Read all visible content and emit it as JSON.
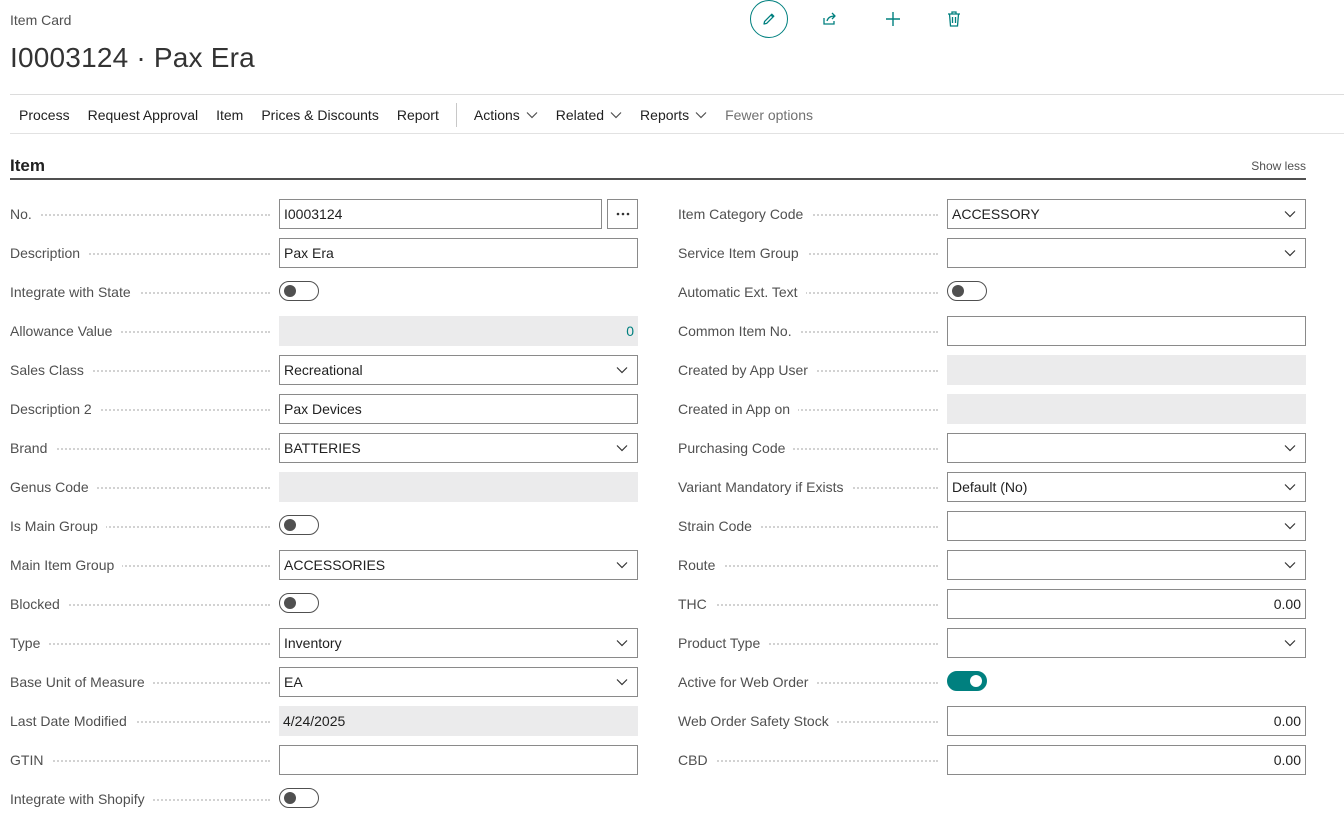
{
  "header": {
    "breadcrumb": "Item Card",
    "title": "I0003124 · Pax Era"
  },
  "top_actions": [
    {
      "name": "edit-icon"
    },
    {
      "name": "share-icon"
    },
    {
      "name": "plus-icon"
    },
    {
      "name": "trash-icon"
    }
  ],
  "menu": {
    "process": "Process",
    "request_approval": "Request Approval",
    "item": "Item",
    "prices_discounts": "Prices & Discounts",
    "report": "Report",
    "actions": "Actions",
    "related": "Related",
    "reports": "Reports",
    "fewer_options": "Fewer options"
  },
  "section": {
    "title": "Item",
    "show_less": "Show less"
  },
  "left": {
    "no": {
      "label": "No.",
      "value": "I0003124"
    },
    "description": {
      "label": "Description",
      "value": "Pax Era"
    },
    "integrate_state": {
      "label": "Integrate with State",
      "on": false
    },
    "allowance_value": {
      "label": "Allowance Value",
      "value": "0"
    },
    "sales_class": {
      "label": "Sales Class",
      "value": "Recreational"
    },
    "description2": {
      "label": "Description 2",
      "value": "Pax Devices"
    },
    "brand": {
      "label": "Brand",
      "value": "BATTERIES"
    },
    "genus_code": {
      "label": "Genus Code",
      "value": ""
    },
    "is_main_group": {
      "label": "Is Main Group",
      "on": false
    },
    "main_item_group": {
      "label": "Main Item Group",
      "value": "ACCESSORIES"
    },
    "blocked": {
      "label": "Blocked",
      "on": false
    },
    "type": {
      "label": "Type",
      "value": "Inventory"
    },
    "base_uom": {
      "label": "Base Unit of Measure",
      "value": "EA"
    },
    "last_date_modified": {
      "label": "Last Date Modified",
      "value": "4/24/2025"
    },
    "gtin": {
      "label": "GTIN",
      "value": ""
    },
    "integrate_shopify": {
      "label": "Integrate with Shopify",
      "on": false
    }
  },
  "right": {
    "item_category_code": {
      "label": "Item Category Code",
      "value": "ACCESSORY"
    },
    "service_item_group": {
      "label": "Service Item Group",
      "value": ""
    },
    "automatic_ext_text": {
      "label": "Automatic Ext. Text",
      "on": false
    },
    "common_item_no": {
      "label": "Common Item No.",
      "value": ""
    },
    "created_by_app_user": {
      "label": "Created by App User",
      "value": ""
    },
    "created_in_app_on": {
      "label": "Created in App on",
      "value": ""
    },
    "purchasing_code": {
      "label": "Purchasing Code",
      "value": ""
    },
    "variant_mandatory": {
      "label": "Variant Mandatory if Exists",
      "value": "Default (No)"
    },
    "strain_code": {
      "label": "Strain Code",
      "value": ""
    },
    "route": {
      "label": "Route",
      "value": ""
    },
    "thc": {
      "label": "THC",
      "value": "0.00"
    },
    "product_type": {
      "label": "Product Type",
      "value": ""
    },
    "active_web_order": {
      "label": "Active for Web Order",
      "on": true
    },
    "web_order_safety_stock": {
      "label": "Web Order Safety Stock",
      "value": "0.00"
    },
    "cbd": {
      "label": "CBD",
      "value": "0.00"
    }
  },
  "colors": {
    "accent": "#00807f",
    "readonly_bg": "#ebebec"
  }
}
